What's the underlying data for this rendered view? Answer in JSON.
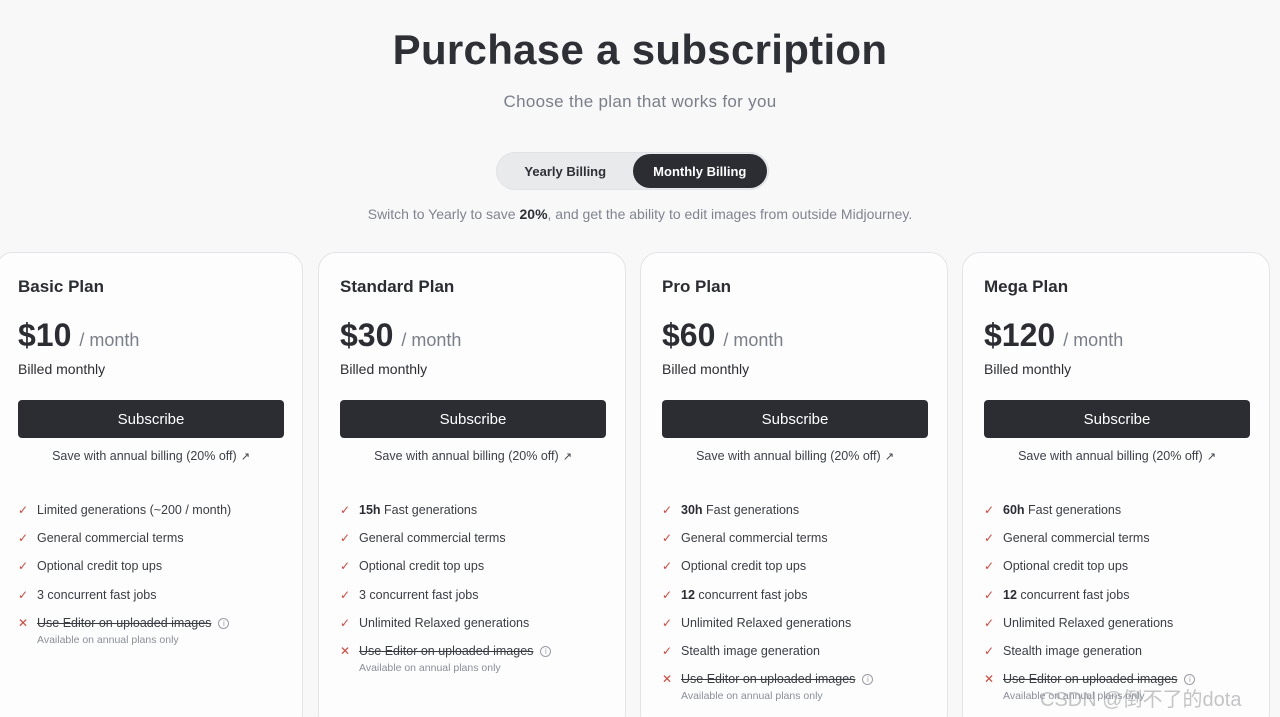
{
  "header": {
    "title": "Purchase a subscription",
    "subtitle": "Choose the plan that works for you"
  },
  "billing_toggle": {
    "options": [
      "Yearly Billing",
      "Monthly Billing"
    ],
    "selected": "Monthly Billing"
  },
  "save_note": {
    "before": "Switch to Yearly to save ",
    "highlight": "20%",
    "after": ", and get the ability to edit images from outside Midjourney."
  },
  "accent_color": "#d9453b",
  "plans": [
    {
      "name": "Basic Plan",
      "price": "$10",
      "per": "/ month",
      "billed": "Billed monthly",
      "subscribe_label": "Subscribe",
      "annual_link": "Save with annual billing (20% off)",
      "features": [
        {
          "icon": "check-icon",
          "bold": "",
          "text": "Limited generations (~200 / month)",
          "disabled": false,
          "note": ""
        },
        {
          "icon": "check-icon",
          "bold": "",
          "text": "General commercial terms",
          "disabled": false,
          "note": ""
        },
        {
          "icon": "check-icon",
          "bold": "",
          "text": "Optional credit top ups",
          "disabled": false,
          "note": ""
        },
        {
          "icon": "check-icon",
          "bold": "",
          "text": "3 concurrent fast jobs",
          "disabled": false,
          "note": ""
        },
        {
          "icon": "cross-icon",
          "bold": "",
          "text": "Use Editor on uploaded images",
          "disabled": true,
          "note": "Available on annual plans only"
        }
      ]
    },
    {
      "name": "Standard Plan",
      "price": "$30",
      "per": "/ month",
      "billed": "Billed monthly",
      "subscribe_label": "Subscribe",
      "annual_link": "Save with annual billing (20% off)",
      "features": [
        {
          "icon": "check-icon",
          "bold": "15h",
          "text": " Fast generations",
          "disabled": false,
          "note": ""
        },
        {
          "icon": "check-icon",
          "bold": "",
          "text": "General commercial terms",
          "disabled": false,
          "note": ""
        },
        {
          "icon": "check-icon",
          "bold": "",
          "text": "Optional credit top ups",
          "disabled": false,
          "note": ""
        },
        {
          "icon": "check-icon",
          "bold": "",
          "text": "3 concurrent fast jobs",
          "disabled": false,
          "note": ""
        },
        {
          "icon": "check-icon",
          "bold": "",
          "text": "Unlimited Relaxed generations",
          "disabled": false,
          "note": ""
        },
        {
          "icon": "cross-icon",
          "bold": "",
          "text": "Use Editor on uploaded images",
          "disabled": true,
          "note": "Available on annual plans only"
        }
      ]
    },
    {
      "name": "Pro Plan",
      "price": "$60",
      "per": "/ month",
      "billed": "Billed monthly",
      "subscribe_label": "Subscribe",
      "annual_link": "Save with annual billing (20% off)",
      "features": [
        {
          "icon": "check-icon",
          "bold": "30h",
          "text": " Fast generations",
          "disabled": false,
          "note": ""
        },
        {
          "icon": "check-icon",
          "bold": "",
          "text": "General commercial terms",
          "disabled": false,
          "note": ""
        },
        {
          "icon": "check-icon",
          "bold": "",
          "text": "Optional credit top ups",
          "disabled": false,
          "note": ""
        },
        {
          "icon": "check-icon",
          "bold": "12",
          "text": " concurrent fast jobs",
          "disabled": false,
          "note": ""
        },
        {
          "icon": "check-icon",
          "bold": "",
          "text": "Unlimited Relaxed generations",
          "disabled": false,
          "note": ""
        },
        {
          "icon": "check-icon",
          "bold": "",
          "text": "Stealth image generation",
          "disabled": false,
          "note": ""
        },
        {
          "icon": "cross-icon",
          "bold": "",
          "text": "Use Editor on uploaded images",
          "disabled": true,
          "note": "Available on annual plans only"
        }
      ]
    },
    {
      "name": "Mega Plan",
      "price": "$120",
      "per": "/ month",
      "billed": "Billed monthly",
      "subscribe_label": "Subscribe",
      "annual_link": "Save with annual billing (20% off)",
      "features": [
        {
          "icon": "check-icon",
          "bold": "60h",
          "text": " Fast generations",
          "disabled": false,
          "note": ""
        },
        {
          "icon": "check-icon",
          "bold": "",
          "text": "General commercial terms",
          "disabled": false,
          "note": ""
        },
        {
          "icon": "check-icon",
          "bold": "",
          "text": "Optional credit top ups",
          "disabled": false,
          "note": ""
        },
        {
          "icon": "check-icon",
          "bold": "12",
          "text": " concurrent fast jobs",
          "disabled": false,
          "note": ""
        },
        {
          "icon": "check-icon",
          "bold": "",
          "text": "Unlimited Relaxed generations",
          "disabled": false,
          "note": ""
        },
        {
          "icon": "check-icon",
          "bold": "",
          "text": "Stealth image generation",
          "disabled": false,
          "note": ""
        },
        {
          "icon": "cross-icon",
          "bold": "",
          "text": "Use Editor on uploaded images",
          "disabled": true,
          "note": "Available on annual plans only"
        }
      ]
    }
  ],
  "watermark": "CSDN @倒不了的dota"
}
